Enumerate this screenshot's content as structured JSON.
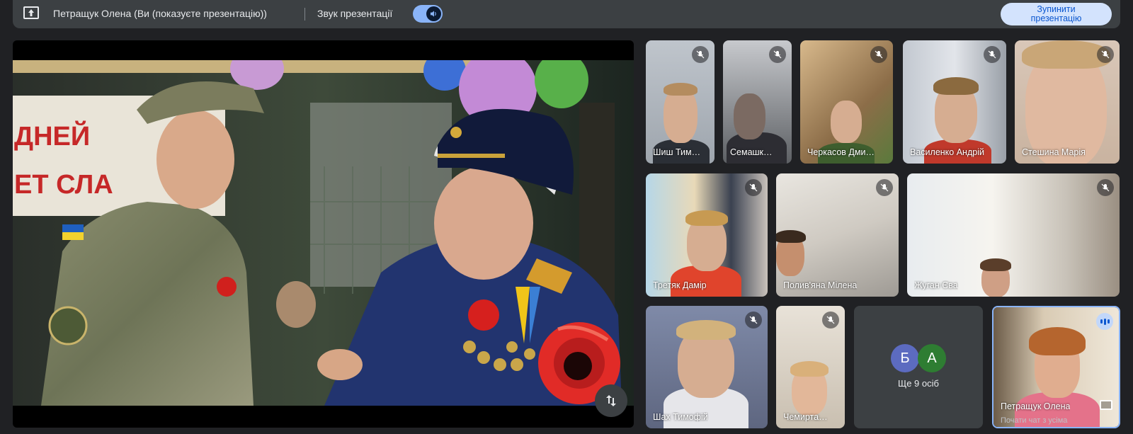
{
  "topbar": {
    "presenter_text": "Петращук Олена (Ви (показуєте презентацію))",
    "sound_label": "Звук презентації",
    "stop_button": "Зупинити\nпрезентацію"
  },
  "slide": {
    "banner_text_top": "ДНЕЙ",
    "banner_text_bottom": "ЕТ СЛА"
  },
  "participants": [
    {
      "name": "Шиш Тим…",
      "muted": true
    },
    {
      "name": "Семашк…",
      "muted": true
    },
    {
      "name": "Черкасов Дми…",
      "muted": true
    },
    {
      "name": "Василенко Андрій",
      "muted": true
    },
    {
      "name": "Стешина Марія",
      "muted": true
    },
    {
      "name": "Третяк Дамір",
      "muted": true
    },
    {
      "name": "Полив'яна Мілена",
      "muted": true
    },
    {
      "name": "Жуган Єва",
      "muted": true
    },
    {
      "name": "Шах Тимофій",
      "muted": true
    },
    {
      "name": "Чемирта…",
      "muted": true
    }
  ],
  "others": {
    "avatars": [
      {
        "letter": "Б",
        "color": "#5c6bc0"
      },
      {
        "letter": "А",
        "color": "#2e7d32"
      }
    ],
    "label": "Ще 9 осіб"
  },
  "self": {
    "name": "Петращук Олена",
    "chat_hint": "Почати чат з усіма"
  },
  "colors": {
    "background": "#202124",
    "topbar": "#3c4043",
    "accent": "#8ab4f8",
    "stop_button_bg": "#d3e3fd"
  }
}
